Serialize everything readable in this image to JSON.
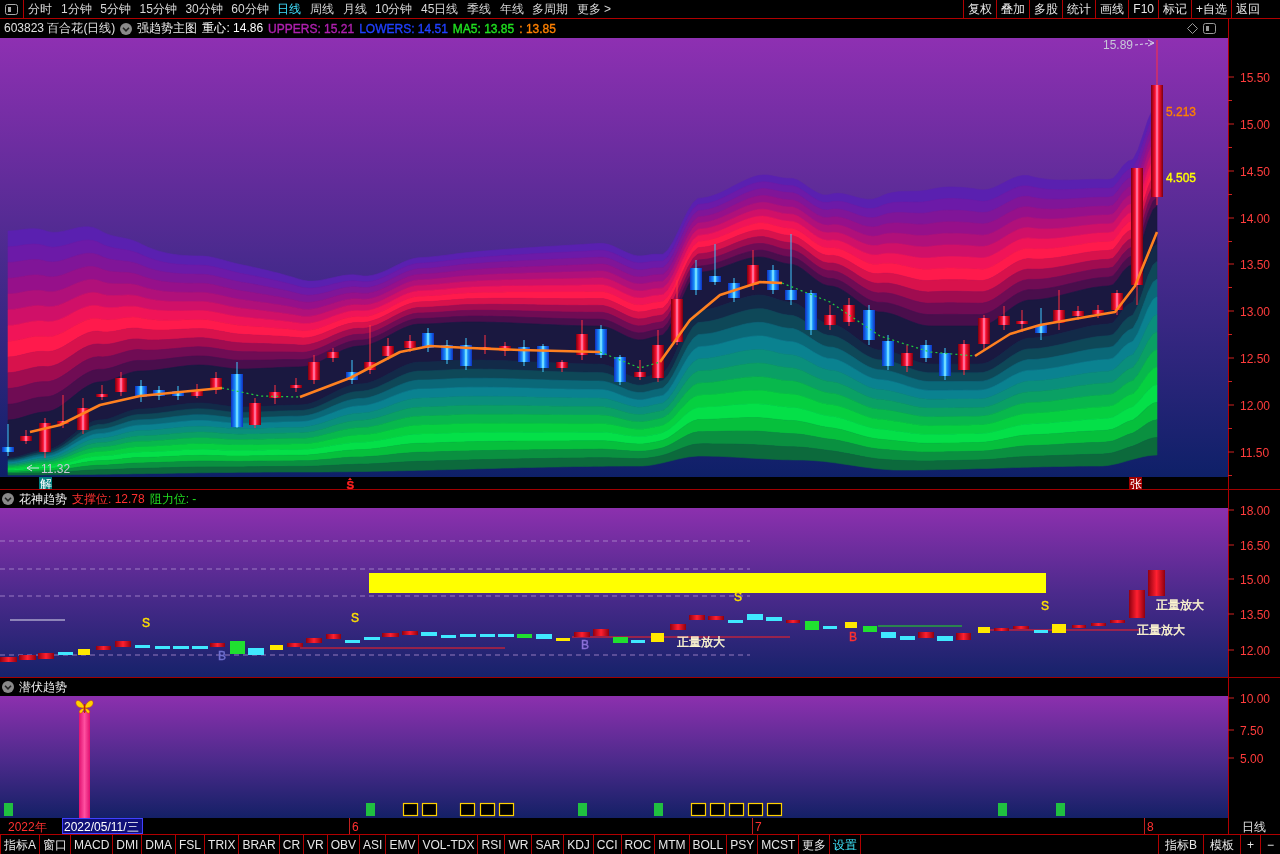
{
  "toolbar": {
    "periods": [
      {
        "label": "分时",
        "selected": false
      },
      {
        "label": "1分钟",
        "selected": false
      },
      {
        "label": "5分钟",
        "selected": false
      },
      {
        "label": "15分钟",
        "selected": false
      },
      {
        "label": "30分钟",
        "selected": false
      },
      {
        "label": "60分钟",
        "selected": false
      },
      {
        "label": "日线",
        "selected": true
      },
      {
        "label": "周线",
        "selected": false
      },
      {
        "label": "月线",
        "selected": false
      },
      {
        "label": "10分钟",
        "selected": false
      },
      {
        "label": "45日线",
        "selected": false
      },
      {
        "label": "季线",
        "selected": false
      },
      {
        "label": "年线",
        "selected": false
      },
      {
        "label": "多周期",
        "selected": false
      },
      {
        "label": "更多 >",
        "selected": false
      }
    ],
    "actions": [
      "复权",
      "叠加",
      "多股",
      "统计",
      "画线",
      "F10",
      "标记",
      "+自选",
      "返回"
    ]
  },
  "main_panel": {
    "symbol": "603823 百合花(日线)",
    "indicator": "强趋势主图",
    "readouts": [
      {
        "text": "重心: 14.86"
      },
      {
        "text": "UPPERS: 15.21",
        "color": "#b020b0"
      },
      {
        "text": "LOWERS: 14.51",
        "color": "#2040ff"
      },
      {
        "text": "MA5: 13.85",
        "color": "#20e020"
      },
      {
        "text": ": 13.85",
        "color": "#ff8000"
      }
    ],
    "high_label": "15.89",
    "low_label": "11.32",
    "band_labels": [
      {
        "text": "5.213",
        "color": "#ff8000"
      },
      {
        "text": "4.505",
        "color": "#ffff00"
      }
    ],
    "axis_labels": [
      "15.50",
      "15.00",
      "14.50",
      "14.00",
      "13.50",
      "13.00",
      "12.50",
      "12.00",
      "11.50"
    ],
    "signals": [
      {
        "text": "解",
        "kind": "badge",
        "color": "#008080"
      },
      {
        "text": "S",
        "kind": "plain",
        "color": "#ff2020"
      },
      {
        "text": "张",
        "kind": "badge",
        "color": "#a00000"
      }
    ]
  },
  "panel2": {
    "title": "花神趋势",
    "support": "支撑位: 12.78",
    "resistance": "阻力位: -",
    "axis_labels": [
      "18.00",
      "16.50",
      "15.00",
      "13.50",
      "12.00"
    ],
    "marks": [
      {
        "text": "S",
        "color": "#ffe000"
      },
      {
        "text": "S",
        "color": "#ffe000"
      },
      {
        "text": "S",
        "color": "#ffe000"
      },
      {
        "text": "S",
        "color": "#ffe000"
      },
      {
        "text": "B",
        "color": "#7070d0"
      },
      {
        "text": "B",
        "color": "#8a70d8"
      },
      {
        "text": "B",
        "color": "#ff3030"
      },
      {
        "text": "正量放大",
        "color": "#fff8d0"
      },
      {
        "text": "正量放大",
        "color": "#fff8d0"
      },
      {
        "text": "正量放大",
        "color": "#fff8d0"
      }
    ]
  },
  "panel3": {
    "title": "潜伏趋势",
    "axis_labels": [
      "10.00",
      "7.50",
      "5.00"
    ]
  },
  "date_bar": {
    "year": "2022年",
    "cursor_date": "2022/05/11/三",
    "months": [
      "6",
      "7",
      "8"
    ],
    "period": "日线"
  },
  "bottom_bar": {
    "tabs": [
      "指标A",
      "窗口",
      "MACD",
      "DMI",
      "DMA",
      "FSL",
      "TRIX",
      "BRAR",
      "CR",
      "VR",
      "OBV",
      "ASI",
      "EMV",
      "VOL-TDX",
      "RSI",
      "WR",
      "SAR",
      "KDJ",
      "CCI",
      "ROC",
      "MTM",
      "BOLL",
      "PSY",
      "MCST",
      "更多"
    ],
    "settings": "设置",
    "right_buttons": [
      "指标B",
      "模板",
      "+",
      "−"
    ]
  }
}
